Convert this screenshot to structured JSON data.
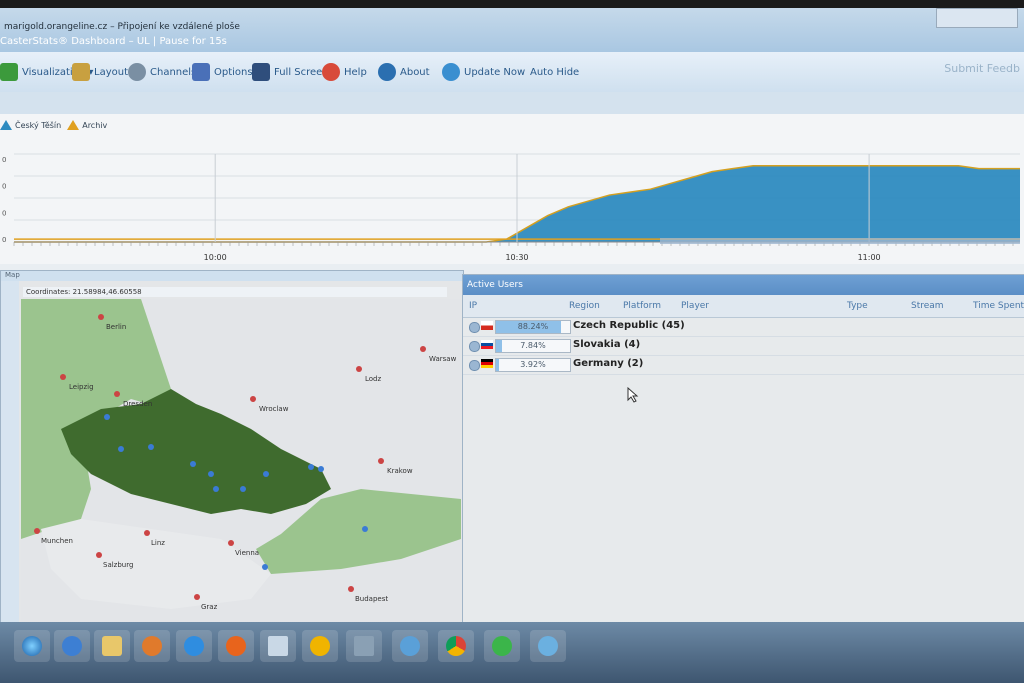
{
  "window": {
    "title": "marigold.orangeline.cz – Připojení ke vzdálené ploše",
    "subtitle": "CasterStats® Dashboard – UL | Pause for 15s"
  },
  "toolbar": {
    "items": [
      {
        "label": "Visualization ▾",
        "icon": "chart-icon",
        "color": "#3c9a3c"
      },
      {
        "label": "Layout ▾",
        "icon": "layout-icon",
        "color": "#c8a040"
      },
      {
        "label": "Channels",
        "icon": "clock-icon",
        "color": "#7a8fa3"
      },
      {
        "label": "Options",
        "icon": "checklist-icon",
        "color": "#4a70b8"
      },
      {
        "label": "Full Screen",
        "icon": "monitor-icon",
        "color": "#2f4e7c"
      },
      {
        "label": "Help",
        "icon": "lifebuoy-icon",
        "color": "#d84a3a"
      },
      {
        "label": "About",
        "icon": "info-icon",
        "color": "#2b6fb0"
      },
      {
        "label": "Update Now",
        "icon": "refresh-icon",
        "color": "#3a8fd0"
      },
      {
        "label": "Auto Hide",
        "icon": "",
        "color": ""
      }
    ],
    "submit": "Submit Feedb"
  },
  "chart": {
    "legend": [
      {
        "label": "Český Těšín",
        "color": "#2e8bc0"
      },
      {
        "label": "Archiv",
        "color": "#e0a020"
      }
    ],
    "y_ticks": [
      "0",
      "0",
      "0",
      "0"
    ],
    "x_ticks": [
      "10:00",
      "10:30",
      "11:00"
    ]
  },
  "chart_data": {
    "type": "area",
    "x_labels": [
      "10:00",
      "10:30",
      "11:00"
    ],
    "series": [
      {
        "name": "Český Těšín",
        "color": "#2e8bc0",
        "values": [
          0,
          0,
          0,
          0,
          0,
          0,
          0,
          0,
          0,
          0,
          0,
          0,
          0,
          0,
          0,
          0,
          0,
          0,
          0,
          0,
          0,
          0,
          0,
          0,
          1,
          5,
          9,
          12,
          14,
          16,
          17,
          18,
          20,
          22,
          24,
          25,
          26,
          26,
          26,
          26,
          26,
          26,
          26,
          26,
          26,
          26,
          26,
          25,
          25,
          25
        ]
      },
      {
        "name": "Archiv",
        "color": "#e0a020",
        "values": [
          1,
          1,
          1,
          1,
          1,
          1,
          1,
          1,
          1,
          1,
          1,
          1,
          1,
          1,
          1,
          1,
          1,
          1,
          1,
          1,
          1,
          1,
          1,
          1,
          1,
          1,
          1,
          1,
          1,
          1,
          1,
          1,
          1,
          1,
          1,
          1,
          1,
          1,
          1,
          1,
          1,
          1,
          1,
          1,
          1,
          1,
          1,
          1,
          1,
          1
        ]
      }
    ],
    "grid": true
  },
  "map": {
    "header": "Map",
    "coordinates": "Coordinates: 21.58984,46.60558",
    "cities": [
      {
        "name": "Berlin"
      },
      {
        "name": "Leipzig"
      },
      {
        "name": "Dresden"
      },
      {
        "name": "Wroclaw"
      },
      {
        "name": "Lodz"
      },
      {
        "name": "Warsaw"
      },
      {
        "name": "Krakow"
      },
      {
        "name": "Munchen"
      },
      {
        "name": "Linz"
      },
      {
        "name": "Salzburg"
      },
      {
        "name": "Vienna"
      },
      {
        "name": "Budapest"
      },
      {
        "name": "Graz"
      }
    ]
  },
  "active_users": {
    "header": "Active Users",
    "columns": [
      "IP",
      "Region",
      "Platform",
      "Player",
      "Type",
      "Stream",
      "Time Spent"
    ],
    "rows": [
      {
        "percent": "88.24%",
        "fraction": 0.8824,
        "country": "Czech Republic (45)",
        "flag": "cz"
      },
      {
        "percent": "7.84%",
        "fraction": 0.0784,
        "country": "Slovakia (4)",
        "flag": "sk"
      },
      {
        "percent": "3.92%",
        "fraction": 0.0392,
        "country": "Germany (2)",
        "flag": "de"
      }
    ]
  },
  "taskbar": {
    "icons": [
      "start-icon",
      "ie-icon",
      "folder-icon",
      "media-player-icon",
      "ie-icon",
      "firefox-icon",
      "notepad-icon",
      "settings-icon",
      "usb-icon",
      "network-icon",
      "chrome-icon",
      "app-icon",
      "app-icon"
    ]
  }
}
